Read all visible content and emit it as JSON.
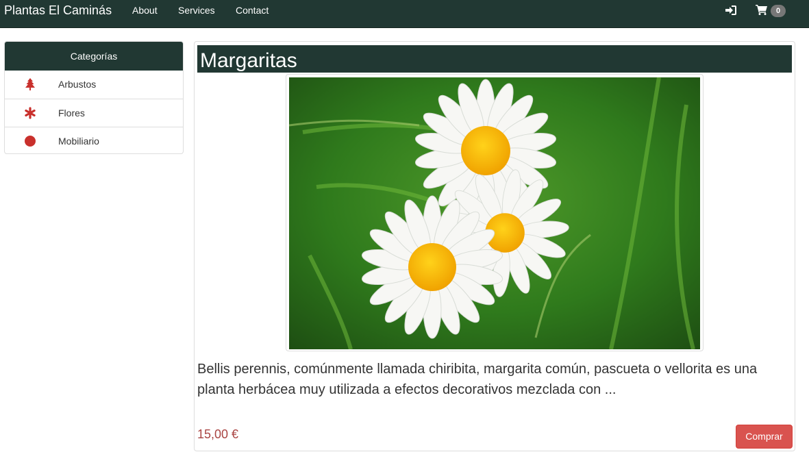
{
  "navbar": {
    "brand": "Plantas El Caminás",
    "links": [
      {
        "label": "About"
      },
      {
        "label": "Services"
      },
      {
        "label": "Contact"
      }
    ],
    "login_icon": "sign-in-icon",
    "cart_icon": "shopping-cart-icon",
    "cart_count": "0"
  },
  "sidebar": {
    "heading": "Categorías",
    "items": [
      {
        "label": "Arbustos",
        "icon": "tree-icon"
      },
      {
        "label": "Flores",
        "icon": "asterisk-icon"
      },
      {
        "label": "Mobiliario",
        "icon": "circle-icon"
      }
    ]
  },
  "product": {
    "title": "Margaritas",
    "image_alt_icon": "daisy-flowers-image",
    "description": "Bellis perennis, comúnmente llamada chiribita, margarita común, pascueta o vellorita es una planta herbácea muy utilizada a efectos decorativos mezclada con ...",
    "price": "15,00 €",
    "buy_label": "Comprar"
  },
  "colors": {
    "navbar_bg": "#213833",
    "accent_red": "#d9534f",
    "price_red": "#a94442",
    "icon_red": "#c9302c"
  }
}
